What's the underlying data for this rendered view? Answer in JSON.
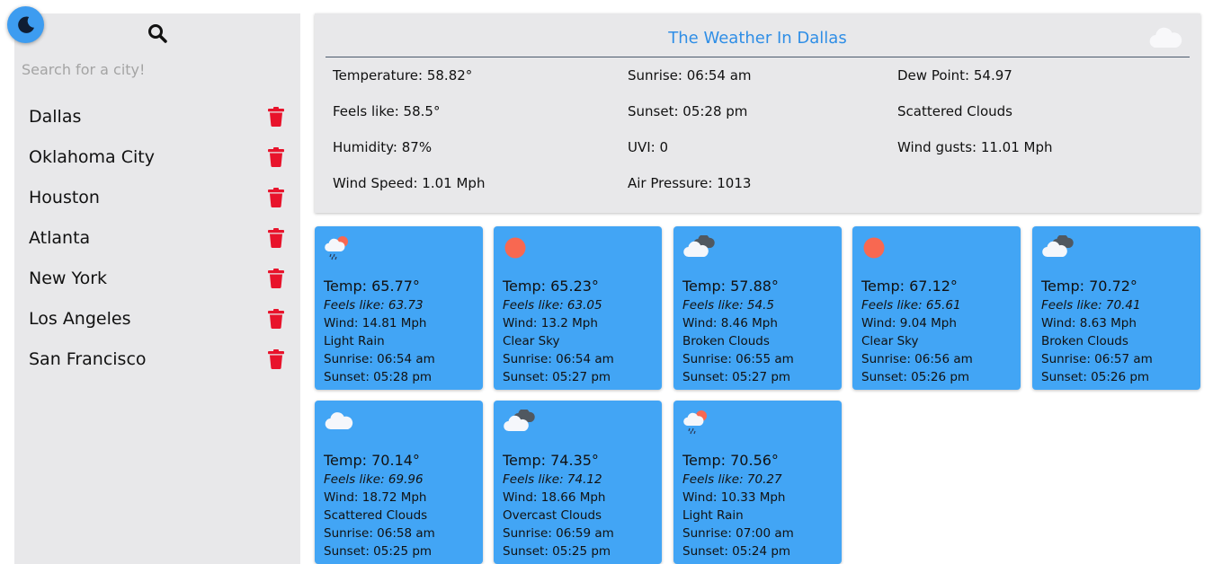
{
  "theme_toggle": {
    "icon": "moon-icon"
  },
  "search": {
    "icon": "search-icon",
    "placeholder": "Search for a city!"
  },
  "cities": [
    {
      "name": "Dallas"
    },
    {
      "name": "Oklahoma City"
    },
    {
      "name": "Houston"
    },
    {
      "name": "Atlanta"
    },
    {
      "name": "New York"
    },
    {
      "name": "Los Angeles"
    },
    {
      "name": "San Francisco"
    }
  ],
  "current": {
    "title": "The Weather In Dallas",
    "icon": "cloud-icon",
    "temperature": "Temperature: 58.82°",
    "feels_like": "Feels like: 58.5°",
    "humidity": "Humidity: 87%",
    "wind_speed": "Wind Speed: 1.01 Mph",
    "sunrise": "Sunrise: 06:54 am",
    "sunset": "Sunset: 05:28 pm",
    "uvi": "UVI: 0",
    "air_pressure": "Air Pressure: 1013",
    "dew_point": "Dew Point: 54.97",
    "description": "Scattered Clouds",
    "wind_gusts": "Wind gusts: 11.01 Mph"
  },
  "forecast": [
    {
      "icon": "rain-sun-icon",
      "temp": "Temp: 65.77°",
      "feels": "Feels like: 63.73",
      "wind": "Wind: 14.81 Mph",
      "desc": "Light Rain",
      "sunrise": "Sunrise: 06:54 am",
      "sunset": "Sunset: 05:28 pm"
    },
    {
      "icon": "sun-icon",
      "temp": "Temp: 65.23°",
      "feels": "Feels like: 63.05",
      "wind": "Wind: 13.2 Mph",
      "desc": "Clear Sky",
      "sunrise": "Sunrise: 06:54 am",
      "sunset": "Sunset: 05:27 pm"
    },
    {
      "icon": "broken-clouds-icon",
      "temp": "Temp: 57.88°",
      "feels": "Feels like: 54.5",
      "wind": "Wind: 8.46 Mph",
      "desc": "Broken Clouds",
      "sunrise": "Sunrise: 06:55 am",
      "sunset": "Sunset: 05:27 pm"
    },
    {
      "icon": "sun-icon",
      "temp": "Temp: 67.12°",
      "feels": "Feels like: 65.61",
      "wind": "Wind: 9.04 Mph",
      "desc": "Clear Sky",
      "sunrise": "Sunrise: 06:56 am",
      "sunset": "Sunset: 05:26 pm"
    },
    {
      "icon": "broken-clouds-icon",
      "temp": "Temp: 70.72°",
      "feels": "Feels like: 70.41",
      "wind": "Wind: 8.63 Mph",
      "desc": "Broken Clouds",
      "sunrise": "Sunrise: 06:57 am",
      "sunset": "Sunset: 05:26 pm"
    },
    {
      "icon": "cloud-icon",
      "temp": "Temp: 70.14°",
      "feels": "Feels like: 69.96",
      "wind": "Wind: 18.72 Mph",
      "desc": "Scattered Clouds",
      "sunrise": "Sunrise: 06:58 am",
      "sunset": "Sunset: 05:25 pm"
    },
    {
      "icon": "broken-clouds-icon",
      "temp": "Temp: 74.35°",
      "feels": "Feels like: 74.12",
      "wind": "Wind: 18.66 Mph",
      "desc": "Overcast Clouds",
      "sunrise": "Sunrise: 06:59 am",
      "sunset": "Sunset: 05:25 pm"
    },
    {
      "icon": "rain-sun-icon",
      "temp": "Temp: 70.56°",
      "feels": "Feels like: 70.27",
      "wind": "Wind: 10.33 Mph",
      "desc": "Light Rain",
      "sunrise": "Sunrise: 07:00 am",
      "sunset": "Sunset: 05:24 pm"
    }
  ],
  "colors": {
    "accent": "#2f8ee6",
    "card": "#42a5f5",
    "panel": "#e8e8ea",
    "trash": "#e8132b",
    "sun": "#f86851"
  }
}
